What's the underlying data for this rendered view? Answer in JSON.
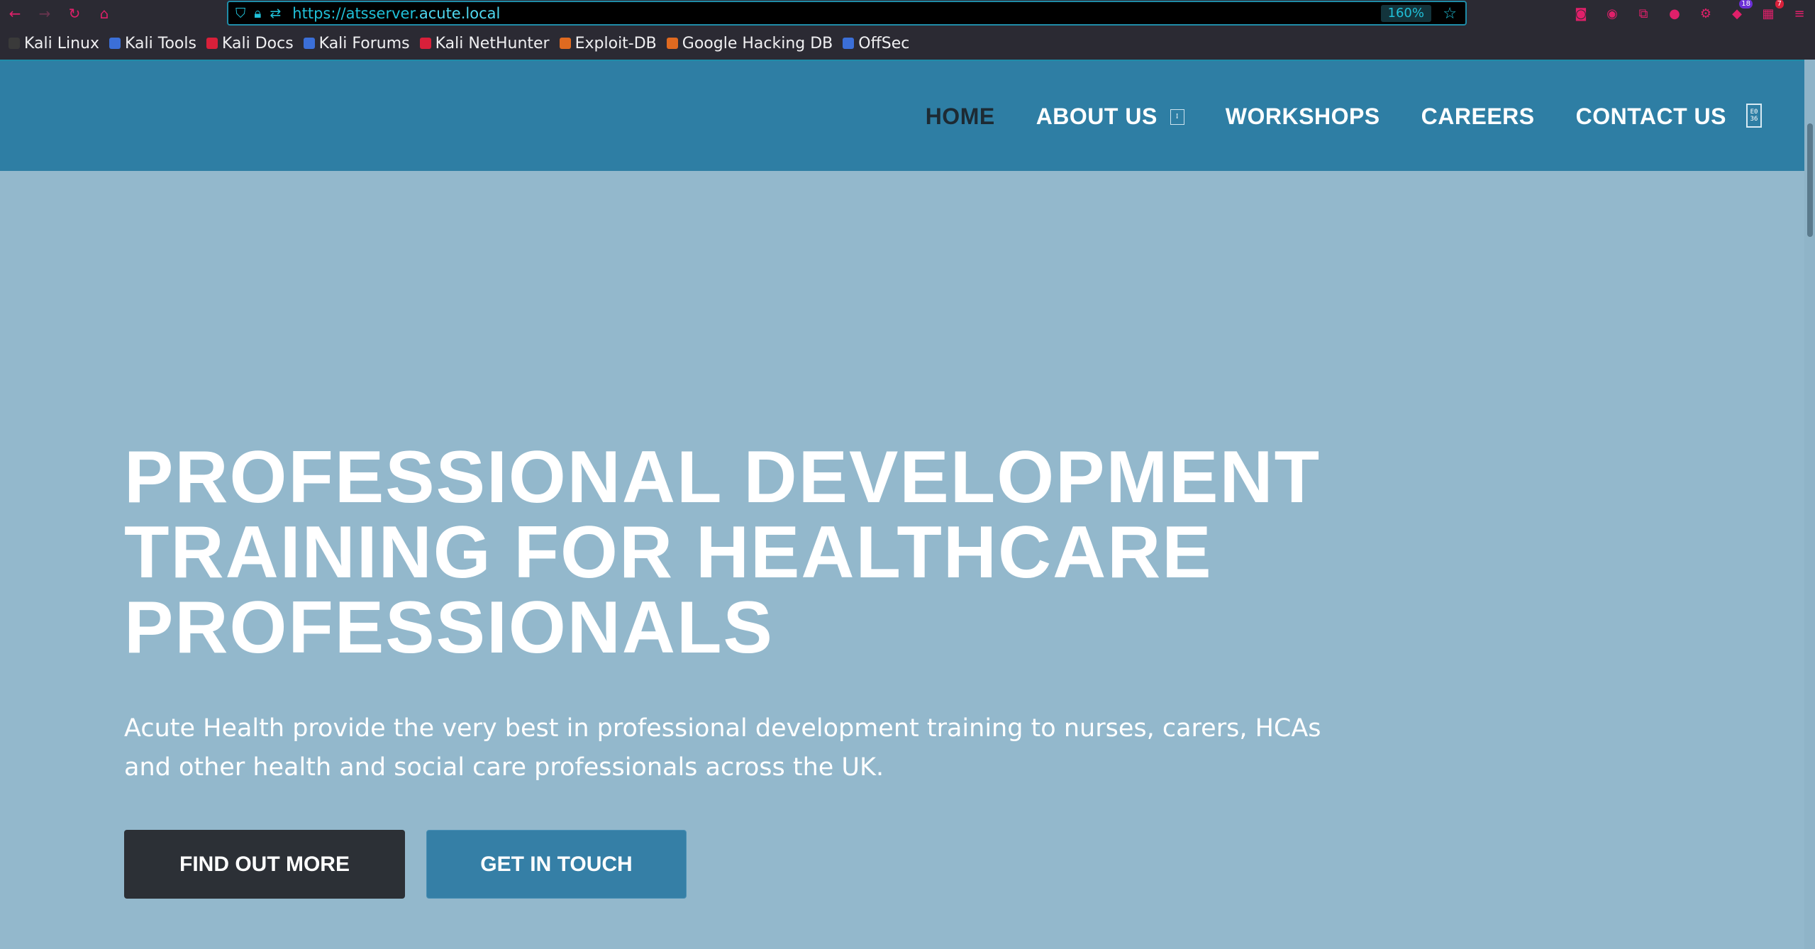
{
  "browser": {
    "url_prefix": "https://atsserver.",
    "url_host": "acute.local",
    "zoom": "160%",
    "toolbar_badges": {
      "extension_count": "18",
      "notifications_count": "7"
    },
    "bookmarks": [
      {
        "label": "Kali Linux",
        "color": "#3a3a3a"
      },
      {
        "label": "Kali Tools",
        "color": "#3b6fd8"
      },
      {
        "label": "Kali Docs",
        "color": "#d8203a"
      },
      {
        "label": "Kali Forums",
        "color": "#3b6fd8"
      },
      {
        "label": "Kali NetHunter",
        "color": "#d8203a"
      },
      {
        "label": "Exploit-DB",
        "color": "#e06a20"
      },
      {
        "label": "Google Hacking DB",
        "color": "#e06a20"
      },
      {
        "label": "OffSec",
        "color": "#3b6fd8"
      }
    ]
  },
  "nav": {
    "home": "HOME",
    "about": "ABOUT US",
    "about_caret": "⁝",
    "workshops": "WORKSHOPS",
    "careers": "CAREERS",
    "contact": "CONTACT US"
  },
  "hero": {
    "title_line1": "PROFESSIONAL DEVELOPMENT",
    "title_line2": "TRAINING FOR HEALTHCARE",
    "title_line3": "PROFESSIONALS",
    "subtitle": "Acute Health provide the very best in professional development training to nurses, carers, HCAs and other health and social care professionals across the UK.",
    "btn_primary": "FIND OUT MORE",
    "btn_secondary": "GET IN TOUCH"
  },
  "colors": {
    "header": "#2e7ea4",
    "hero_bg": "#93b8cc",
    "btn_dark": "#2c3036",
    "btn_blue": "#357fa6",
    "chrome": "#2b2a33",
    "accent": "#20c0d8"
  }
}
